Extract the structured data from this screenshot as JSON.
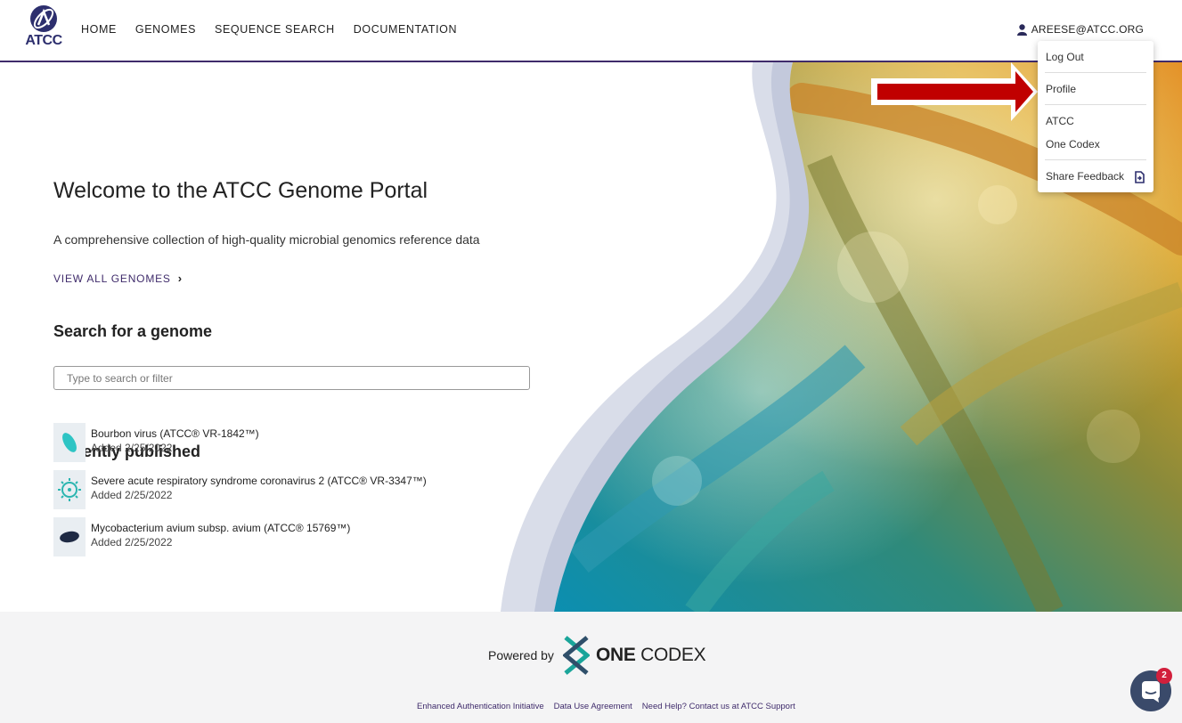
{
  "header": {
    "logo_text": "ATCC",
    "nav": [
      "HOME",
      "GENOMES",
      "SEQUENCE SEARCH",
      "DOCUMENTATION"
    ],
    "user_email": "AREESE@ATCC.ORG"
  },
  "dropdown": {
    "items": [
      "Log Out",
      "Profile",
      "ATCC",
      "One Codex",
      "Share Feedback"
    ]
  },
  "hero": {
    "title": "Welcome to the ATCC Genome Portal",
    "subtitle": "A comprehensive collection of high-quality microbial genomics reference data",
    "view_all": "VIEW ALL GENOMES",
    "search_title": "Search for a genome",
    "search_placeholder": "Type to search or filter",
    "recent_title": "Recently published",
    "recent": [
      {
        "name": "Bourbon virus (ATCC® VR-1842™)",
        "added": "Added 2/25/2022",
        "icon": "virus-capsule-icon"
      },
      {
        "name": "Severe acute respiratory syndrome coronavirus 2 (ATCC® VR-3347™)",
        "added": "Added 2/25/2022",
        "icon": "coronavirus-icon"
      },
      {
        "name": "Mycobacterium avium subsp. avium (ATCC® 15769™)",
        "added": "Added 2/25/2022",
        "icon": "bacterium-icon"
      }
    ]
  },
  "footer": {
    "powered_by": "Powered by",
    "brand_bold": "ONE",
    "brand_light": " CODEX",
    "links": [
      "Enhanced Authentication Initiative",
      "Data Use Agreement",
      "Need Help? Contact us at ATCC Support"
    ]
  },
  "chat": {
    "badge": "2"
  },
  "colors": {
    "accent": "#3f2b6b",
    "arrow": "#c00000",
    "teal": "#2bb5b0"
  }
}
